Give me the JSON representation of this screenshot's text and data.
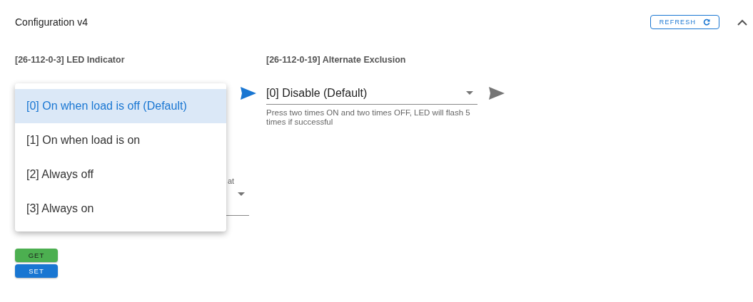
{
  "panel": {
    "title": "Configuration v4",
    "refresh_button": "REFRESH",
    "expanded": true
  },
  "parameters": [
    {
      "label": "[26-112-0-3] LED Indicator",
      "send_enabled": true
    },
    {
      "label": "[26-112-0-19] Alternate Exclusion",
      "value": "[0] Disable (Default)",
      "helper": "Press two times ON and two times OFF, LED will flash 5 times if successful",
      "send_enabled": false
    }
  ],
  "partial_field": {
    "label": "at"
  },
  "menu": {
    "items": [
      {
        "label": "[0] On when load is off (Default)",
        "selected": true
      },
      {
        "label": "[1] On when load is on",
        "selected": false
      },
      {
        "label": "[2] Always off",
        "selected": false
      },
      {
        "label": "[3] Always on",
        "selected": false
      }
    ]
  },
  "buttons": [
    {
      "label": "GET",
      "kind": "get"
    },
    {
      "label": "SET",
      "kind": "set"
    }
  ]
}
